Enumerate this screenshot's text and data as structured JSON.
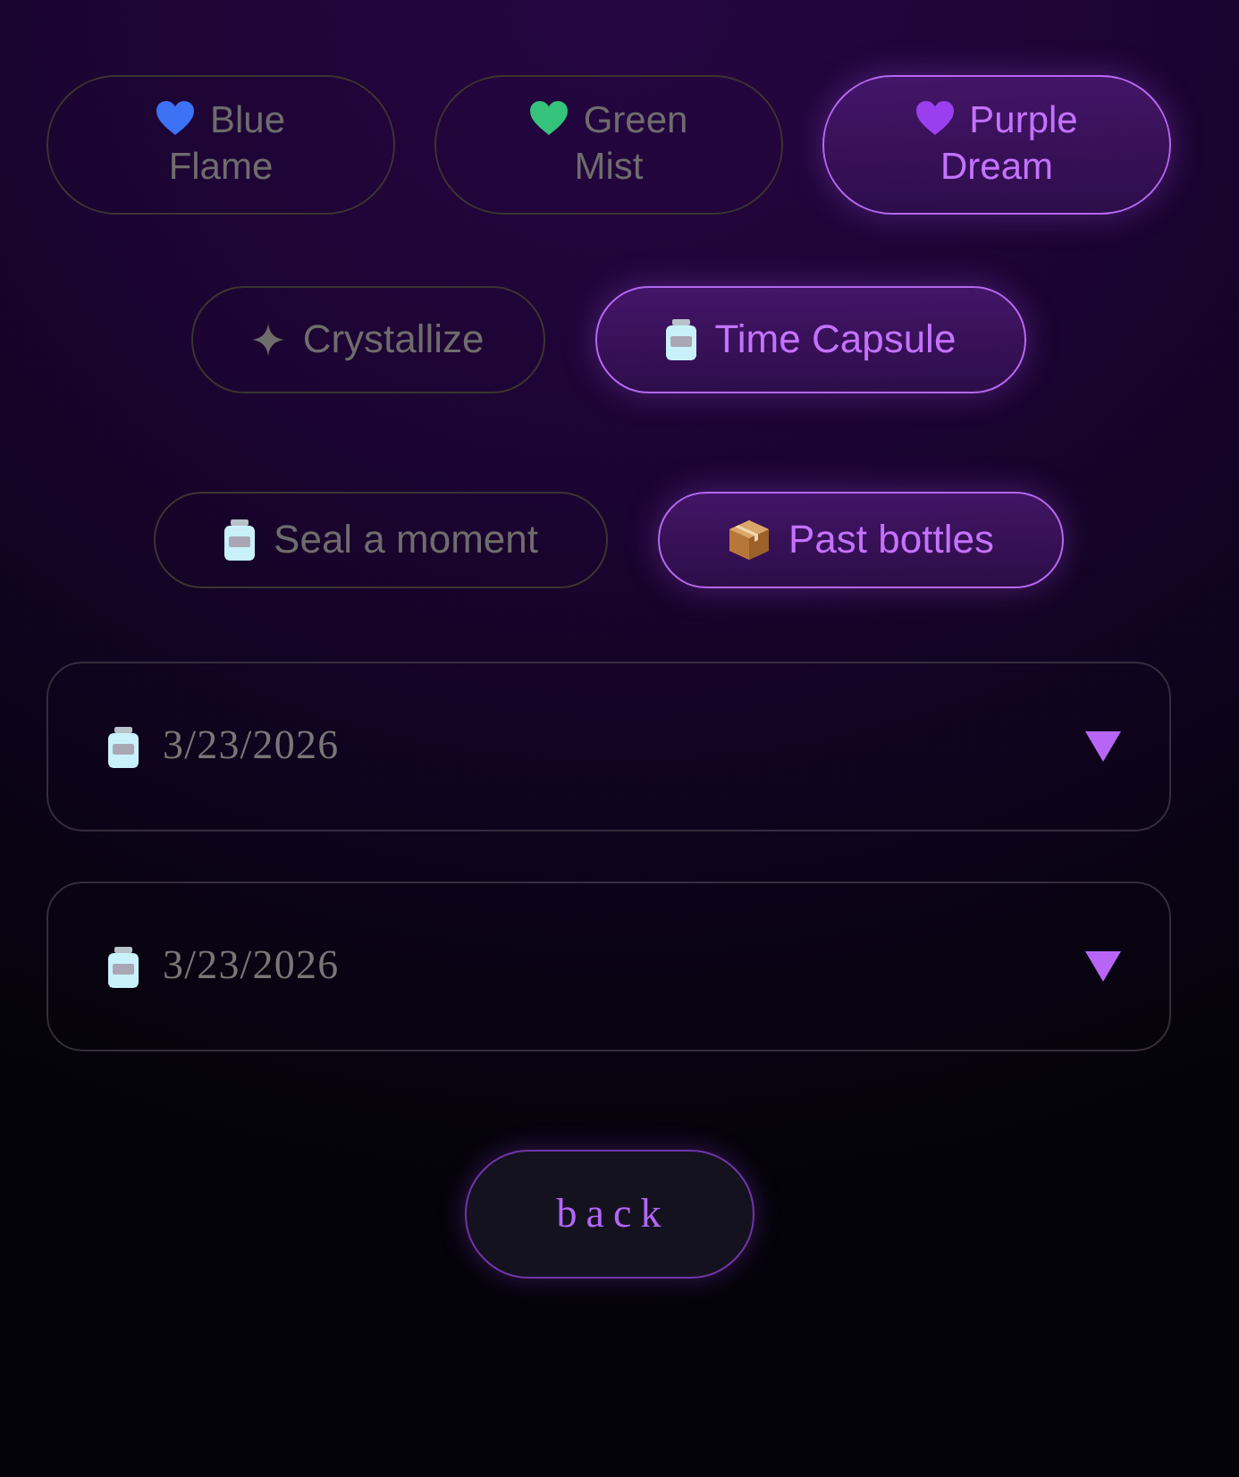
{
  "themes": [
    {
      "label": "Blue Flame",
      "color": "#3d72f5",
      "selected": false
    },
    {
      "label": "Green Mist",
      "color": "#35c27a",
      "selected": false
    },
    {
      "label": "Purple Dream",
      "color": "#9a3ff0",
      "selected": true
    }
  ],
  "modes": [
    {
      "label": "Crystallize",
      "kind": "sparkle",
      "selected": false
    },
    {
      "label": "Time Capsule",
      "kind": "jar",
      "selected": true
    }
  ],
  "views": [
    {
      "label": "Seal a moment",
      "kind": "jar",
      "selected": false
    },
    {
      "label": "Past bottles",
      "kind": "box",
      "selected": true
    }
  ],
  "date_fields": [
    {
      "value": "3/23/2026"
    },
    {
      "value": "3/23/2026"
    }
  ],
  "back_button": {
    "label": "back"
  }
}
